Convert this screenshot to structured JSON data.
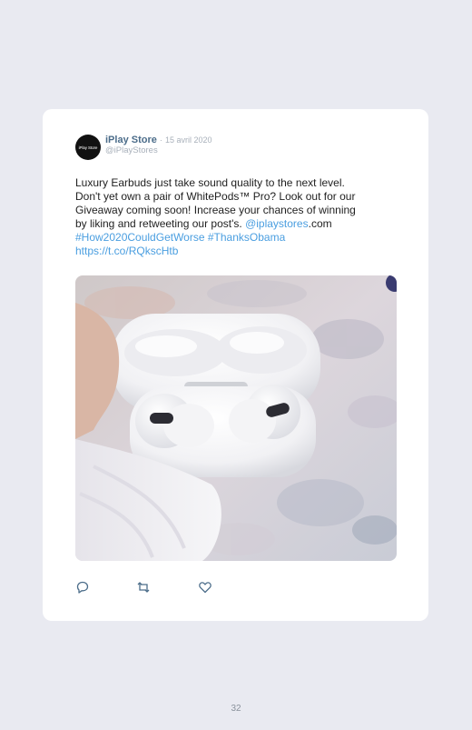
{
  "tweet": {
    "avatar_text": "iPlay Store",
    "display_name": "iPlay Store",
    "separator": "·",
    "date": "15 avril 2020",
    "handle": "@iPlayStores",
    "body_lines": [
      "Luxury Earbuds just take sound quality to the next level.",
      "Don't yet own a pair of WhitePods™ Pro? Look out for our",
      "Giveaway coming soon! Increase your chances of winning",
      "by liking and retweeting our post's. "
    ],
    "mention": "@iplaystores",
    "mention_suffix": ".com",
    "hashtag_1": "#How2020CouldGetWorse",
    "hashtag_2": "#ThanksObama",
    "url": "https://t.co/RQkscHtb"
  },
  "actions": {
    "reply_icon": "reply-icon",
    "retweet_icon": "retweet-icon",
    "like_icon": "heart-icon"
  },
  "page_number": "32",
  "colors": {
    "background": "#e9eaf1",
    "card": "#ffffff",
    "link": "#4a9ee0",
    "display_name": "#4c6d8a",
    "muted": "#a8b0ba"
  }
}
